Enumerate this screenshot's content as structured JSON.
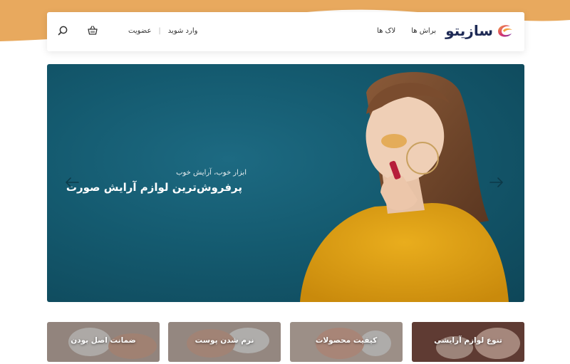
{
  "brand": {
    "name": "سازیتو",
    "accent": "#e8a95e",
    "logo_gradient": [
      "#f4a340",
      "#d6316f",
      "#7a3fb0"
    ]
  },
  "header": {
    "nav": [
      {
        "label": "براش ها"
      },
      {
        "label": "لاک ها"
      }
    ],
    "login_label": "وارد شوید",
    "separator": "|",
    "register_label": "عضویت",
    "cart_icon": "basket-icon",
    "search_icon": "search-icon"
  },
  "hero": {
    "subtitle": "ابزار خوب، آرایش خوب",
    "title": "پرفروش‌ترین لوازم آرایش صورت",
    "background": "#145a6f",
    "prev_icon": "arrow-left-icon",
    "next_icon": "arrow-right-icon"
  },
  "features": [
    {
      "label": "تنوع لوازم آرایشی"
    },
    {
      "label": "کیفیت محصولات"
    },
    {
      "label": "نرم شدن پوست"
    },
    {
      "label": "ضمانت اصل بودن"
    }
  ]
}
